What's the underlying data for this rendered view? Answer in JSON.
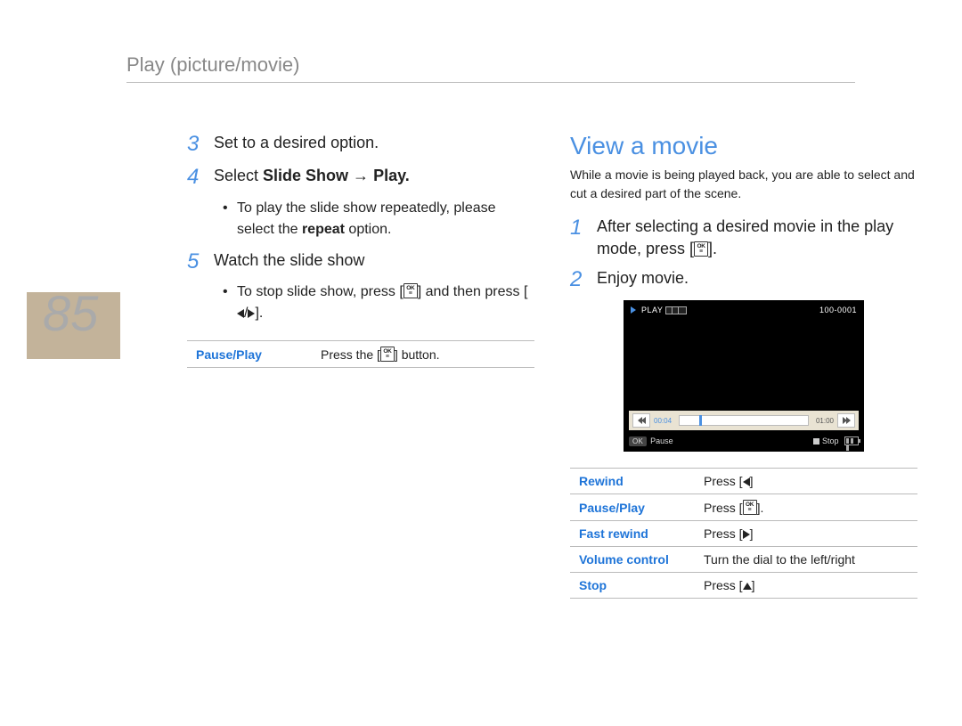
{
  "header": {
    "title": "Play (picture/movie)"
  },
  "page_number": "85",
  "left": {
    "steps": {
      "s3": {
        "num": "3",
        "text": "Set to a desired option."
      },
      "s4": {
        "num": "4",
        "prefix": "Select ",
        "bold": "Slide Show",
        "arrow": " → ",
        "bold2": "Play."
      },
      "s4b1_a": "To play the slide show repeatedly, please select the ",
      "s4b1_b": "repeat",
      "s4b1_c": " option.",
      "s5": {
        "num": "5",
        "text": "Watch the slide show"
      },
      "s5b1_a": "To stop slide show, press [",
      "s5b1_b": "] and then press [",
      "s5b1_c": "/",
      "s5b1_d": "]."
    },
    "table": {
      "r1": {
        "label": "Pause/Play",
        "val_a": "Press the [",
        "val_b": "] button."
      }
    }
  },
  "right": {
    "title": "View a movie",
    "intro": "While a movie is being played back, you are able to select and cut a desired part of the scene.",
    "steps": {
      "s1": {
        "num": "1",
        "text_a": "After selecting a desired movie in the play mode, press [",
        "text_b": "]."
      },
      "s2": {
        "num": "2",
        "text": "Enjoy movie."
      }
    },
    "preview": {
      "play_label": "PLAY",
      "file_counter": "100-0001",
      "time_current": "00:04",
      "time_total": "01:00",
      "ok_label": "OK",
      "pause_label": "Pause",
      "stop_label": "Stop"
    },
    "table": {
      "r1": {
        "label": "Rewind",
        "val": "Press [",
        "val_b": "]"
      },
      "r2": {
        "label": "Pause/Play",
        "val": "Press [",
        "val_b": "]."
      },
      "r3": {
        "label": "Fast rewind",
        "val": "Press [",
        "val_b": "]"
      },
      "r4": {
        "label": "Volume control",
        "val": "Turn the dial to the left/right"
      },
      "r5": {
        "label": "Stop",
        "val": "Press [",
        "val_b": "]"
      }
    }
  }
}
